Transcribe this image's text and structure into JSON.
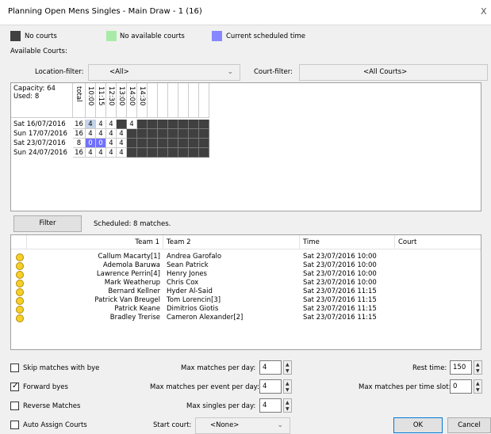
{
  "window": {
    "title": "Planning Open Mens Singles - Main Draw - 1 (16)",
    "close": "X"
  },
  "legend": [
    {
      "label": "No courts",
      "color": "#404040"
    },
    {
      "label": "No available courts",
      "color": "#a8eba8"
    },
    {
      "label": "Current scheduled time",
      "color": "#8787ff"
    }
  ],
  "available_courts_label": "Available Courts:",
  "filters": {
    "location_label": "Location-filter:",
    "location_value": "<All>",
    "court_label": "Court-filter:",
    "court_value": "<All Courts>"
  },
  "grid": {
    "capacity": "Capacity: 64",
    "used": "Used: 8",
    "columns": [
      "total",
      "10:00",
      "11:15",
      "12:30",
      "13:00",
      "14:00",
      "14:30"
    ],
    "rows": [
      {
        "date": "Sat 16/07/2016",
        "total": "16",
        "cells": [
          "4",
          "4",
          "4",
          "",
          "4"
        ]
      },
      {
        "date": "Sun 17/07/2016",
        "total": "16",
        "cells": [
          "4",
          "4",
          "4",
          "4",
          ""
        ]
      },
      {
        "date": "Sat 23/07/2016",
        "total": "8",
        "cells": [
          "0",
          "0",
          "4",
          "4",
          ""
        ]
      },
      {
        "date": "Sun 24/07/2016",
        "total": "16",
        "cells": [
          "4",
          "4",
          "4",
          "4",
          ""
        ]
      }
    ]
  },
  "filter_button": "Filter",
  "scheduled_text": "Scheduled: 8 matches.",
  "table": {
    "headers": [
      "Team 1",
      "Team 2",
      "Time",
      "Court"
    ],
    "rows": [
      {
        "team1": "Callum Macarty[1]",
        "team2": "Andrea Garofalo",
        "time": "Sat 23/07/2016 10:00",
        "court": ""
      },
      {
        "team1": "Ademola Baruwa",
        "team2": "Sean Patrick",
        "time": "Sat 23/07/2016 10:00",
        "court": ""
      },
      {
        "team1": "Lawrence Perrin[4]",
        "team2": "Henry Jones",
        "time": "Sat 23/07/2016 10:00",
        "court": ""
      },
      {
        "team1": "Mark Weatherup",
        "team2": "Chris Cox",
        "time": "Sat 23/07/2016 10:00",
        "court": ""
      },
      {
        "team1": "Bernard Kellner",
        "team2": "Hyder Al-Said",
        "time": "Sat 23/07/2016 11:15",
        "court": ""
      },
      {
        "team1": "Patrick Van Breugel",
        "team2": "Tom Lorencin[3]",
        "time": "Sat 23/07/2016 11:15",
        "court": ""
      },
      {
        "team1": "Patrick Keane",
        "team2": "Dimitrios Giotis",
        "time": "Sat 23/07/2016 11:15",
        "court": ""
      },
      {
        "team1": "Bradley Trerise",
        "team2": "Cameron Alexander[2]",
        "time": "Sat 23/07/2016 11:15",
        "court": ""
      }
    ]
  },
  "options": {
    "skip_bye": {
      "label": "Skip matches with bye",
      "checked": false
    },
    "forward_byes": {
      "label": "Forward byes",
      "checked": true
    },
    "reverse": {
      "label": "Reverse Matches",
      "checked": false
    },
    "auto_assign": {
      "label": "Auto Assign Courts",
      "checked": false
    },
    "max_per_day": {
      "label": "Max matches per day:",
      "value": "4"
    },
    "max_per_event": {
      "label": "Max matches per event per day:",
      "value": "4"
    },
    "max_singles": {
      "label": "Max singles per day:",
      "value": "4"
    },
    "start_court": {
      "label": "Start court:",
      "value": "<None>"
    },
    "rest_time": {
      "label": "Rest time:",
      "value": "150"
    },
    "max_per_slot": {
      "label": "Max matches per time slot:",
      "value": "0"
    }
  },
  "buttons": {
    "ok": "OK",
    "cancel": "Cancel"
  }
}
